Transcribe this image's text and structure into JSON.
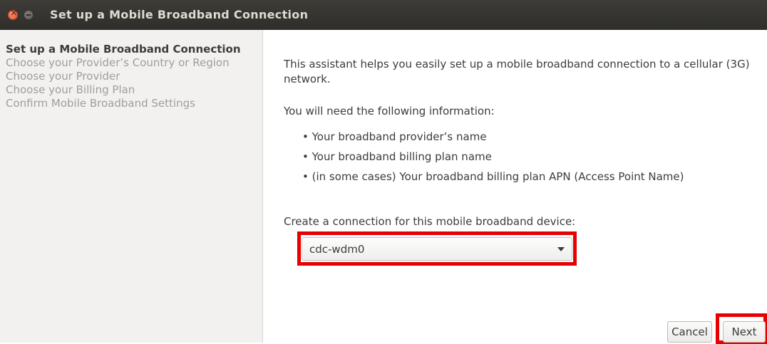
{
  "window": {
    "title": "Set up a Mobile Broadband Connection"
  },
  "sidebar": {
    "steps": [
      {
        "label": "Set up a Mobile Broadband Connection",
        "active": true
      },
      {
        "label": "Choose your Provider’s Country or Region",
        "active": false
      },
      {
        "label": "Choose your Provider",
        "active": false
      },
      {
        "label": "Choose your Billing Plan",
        "active": false
      },
      {
        "label": "Confirm Mobile Broadband Settings",
        "active": false
      }
    ]
  },
  "main": {
    "intro": "This assistant helps you easily set up a mobile broadband connection to a cellular (3G) network.",
    "need_info": "You will need the following information:",
    "bullets": [
      "• Your broadband provider’s name",
      "• Your broadband billing plan name",
      "• (in some cases) Your broadband billing plan APN (Access Point Name)"
    ],
    "device_label": "Create a connection for this mobile broadband device:",
    "device_value": "cdc-wdm0"
  },
  "buttons": {
    "cancel": "Cancel",
    "next": "Next"
  },
  "colors": {
    "highlight": "#e80000",
    "titlebar": "#3d3c37",
    "close_button": "#e25a31"
  }
}
